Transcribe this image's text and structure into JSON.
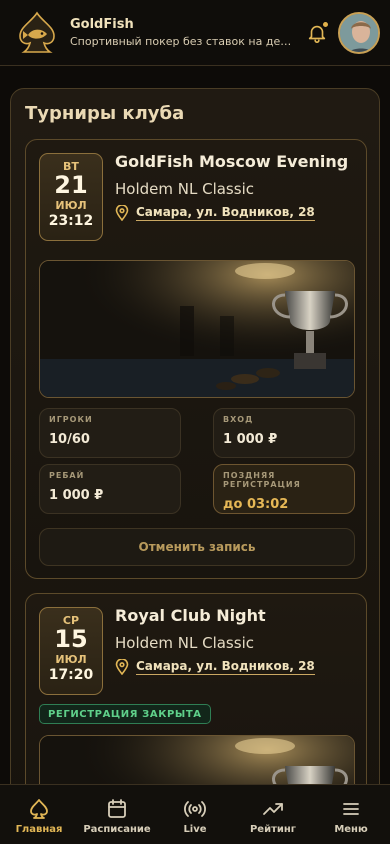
{
  "header": {
    "title": "GoldFish",
    "subtitle": "Спортивный покер без ставок на деньги",
    "icons": [
      "spade-fish-logo",
      "bell-icon",
      "avatar"
    ]
  },
  "panel": {
    "title": "Турниры клуба"
  },
  "tournaments": [
    {
      "dow": "ВТ",
      "day": "21",
      "month": "ИЮЛ",
      "time": "23:12",
      "name": "GoldFish Moscow Evening",
      "game": "Holdem NL Classic",
      "location": "Самара, ул. Водников, 28",
      "stats": [
        {
          "label": "ИГРОКИ",
          "value": "10/60"
        },
        {
          "label": "ВХОД",
          "value": "1 000 ₽"
        },
        {
          "label": "РЕБАЙ",
          "value": "1 000 ₽"
        },
        {
          "label": "ПОЗДНЯЯ РЕГИСТРАЦИЯ",
          "value": "до 03:02"
        }
      ],
      "action": "Отменить запись"
    },
    {
      "dow": "СР",
      "day": "15",
      "month": "ИЮЛ",
      "time": "17:20",
      "name": "Royal Club Night",
      "game": "Holdem NL Classic",
      "location": "Самара, ул. Водников, 28",
      "status": "РЕГИСТРАЦИЯ ЗАКРЫТА"
    }
  ],
  "nav": [
    {
      "label": "Главная",
      "icon": "spade-icon",
      "active": true
    },
    {
      "label": "Расписание",
      "icon": "calendar-icon"
    },
    {
      "label": "Live",
      "icon": "broadcast-icon"
    },
    {
      "label": "Рейтинг",
      "icon": "trend-icon"
    },
    {
      "label": "Меню",
      "icon": "menu-icon"
    }
  ],
  "colors": {
    "accent": "#e2b756",
    "background": "#0d0b08",
    "closed": "#5fd08a"
  }
}
